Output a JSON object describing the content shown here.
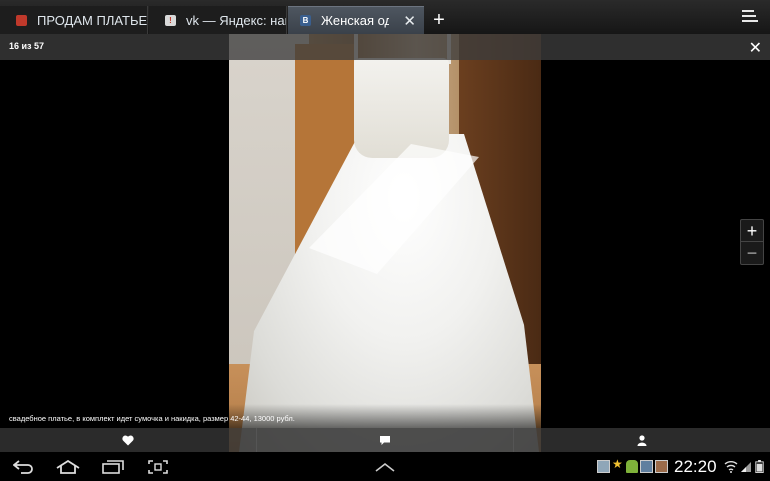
{
  "browser": {
    "tabs": [
      {
        "title": "ПРОДАМ ПЛАТЬЕ",
        "favicon_color": "#c0392b",
        "active": false
      },
      {
        "title": "vk — Яндекс: наш",
        "favicon_color": "#d9d9d9",
        "active": false
      },
      {
        "title": "Женская од",
        "favicon_color": "#3a5f8f",
        "favicon_letter": "B",
        "active": true
      }
    ],
    "new_tab_label": "+",
    "menu_icon": "overflow-menu-icon"
  },
  "viewer": {
    "counter": "16 из 57",
    "caption": "свадебное платье, в комплект идет сумочка и накидка, размер 42-44, 13000 рубл.",
    "actions": [
      {
        "icon": "heart-icon"
      },
      {
        "icon": "comment-icon"
      },
      {
        "icon": "person-icon"
      }
    ],
    "zoom_in": "+",
    "zoom_out": "−"
  },
  "statusbar": {
    "time": "22:20"
  },
  "colors": {
    "tabbar_bg": "#1a1a1a",
    "active_tab": "#444b55"
  }
}
